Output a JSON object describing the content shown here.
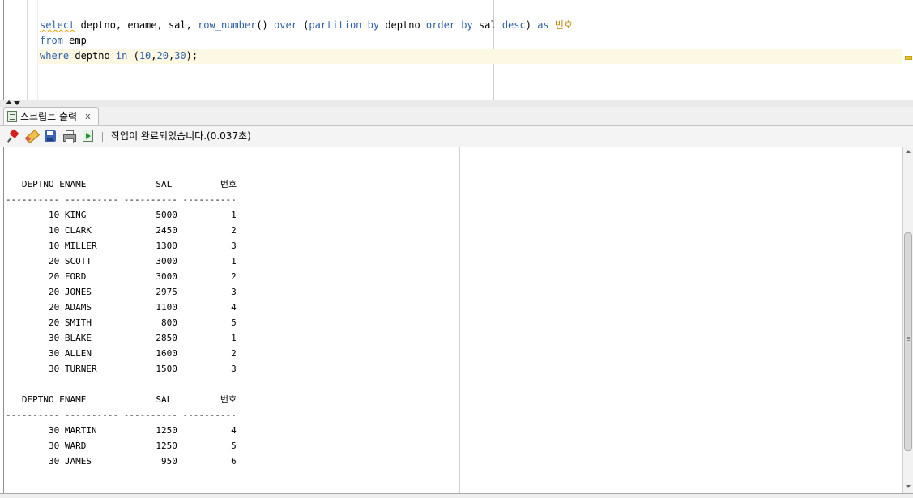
{
  "editor": {
    "lines": [
      {
        "parts": [
          {
            "t": "select",
            "c": "kw squig"
          },
          {
            "t": " deptno, ename, sal, ",
            "c": ""
          },
          {
            "t": "row_number",
            "c": "fn"
          },
          {
            "t": "() ",
            "c": ""
          },
          {
            "t": "over",
            "c": "kw"
          },
          {
            "t": " (",
            "c": ""
          },
          {
            "t": "partition",
            "c": "kw"
          },
          {
            "t": " ",
            "c": ""
          },
          {
            "t": "by",
            "c": "kw"
          },
          {
            "t": " deptno ",
            "c": ""
          },
          {
            "t": "order",
            "c": "kw"
          },
          {
            "t": " ",
            "c": ""
          },
          {
            "t": "by",
            "c": "kw"
          },
          {
            "t": " sal ",
            "c": ""
          },
          {
            "t": "desc",
            "c": "kw"
          },
          {
            "t": ") ",
            "c": ""
          },
          {
            "t": "as",
            "c": "kw"
          },
          {
            "t": " ",
            "c": ""
          },
          {
            "t": "번호",
            "c": "alias"
          }
        ]
      },
      {
        "parts": [
          {
            "t": "from",
            "c": "kw"
          },
          {
            "t": " emp",
            "c": ""
          }
        ]
      },
      {
        "parts": [
          {
            "t": "where",
            "c": "kw"
          },
          {
            "t": " deptno ",
            "c": ""
          },
          {
            "t": "in",
            "c": "kw"
          },
          {
            "t": " (",
            "c": ""
          },
          {
            "t": "10",
            "c": "num"
          },
          {
            "t": ",",
            "c": ""
          },
          {
            "t": "20",
            "c": "num"
          },
          {
            "t": ",",
            "c": ""
          },
          {
            "t": "30",
            "c": "num"
          },
          {
            "t": ");",
            "c": ""
          }
        ]
      }
    ],
    "marker_color": "#e8c22a"
  },
  "tab": {
    "label": "스크립트 출력",
    "close": "x"
  },
  "toolbar": {
    "icons": [
      "pin-icon",
      "eraser-icon",
      "save-icon",
      "print-icon",
      "run-script-icon"
    ],
    "status": "작업이 완료되었습니다.(0.037초)"
  },
  "output": {
    "header": "   DEPTNO ENAME             SAL         번호",
    "separator": "---------- ---------- ---------- ----------",
    "block1": [
      "        10 KING             5000          1",
      "        10 CLARK            2450          2",
      "        10 MILLER           1300          3",
      "        20 SCOTT            3000          1",
      "        20 FORD             3000          2",
      "        20 JONES            2975          3",
      "        20 ADAMS            1100          4",
      "        20 SMITH             800          5",
      "        30 BLAKE            2850          1",
      "        30 ALLEN            1600          2",
      "        30 TURNER           1500          3"
    ],
    "block2": [
      "        30 MARTIN           1250          4",
      "        30 WARD             1250          5",
      "        30 JAMES             950          6"
    ]
  }
}
